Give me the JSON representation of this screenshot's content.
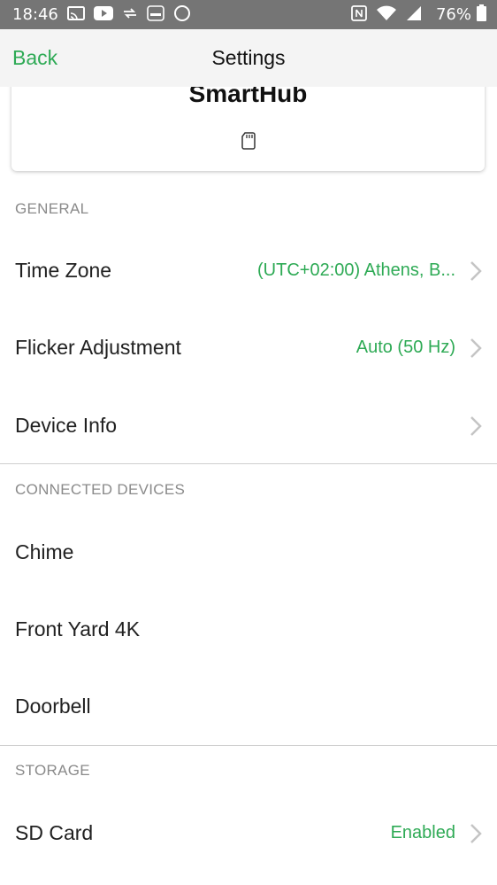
{
  "status_bar": {
    "time": "18:46",
    "battery": "76%",
    "icons_left": [
      "cast-icon",
      "youtube-icon",
      "sync-icon",
      "connect-icon",
      "circle-icon"
    ],
    "icons_right": [
      "nfc-icon",
      "wifi-icon",
      "signal-icon",
      "battery-icon"
    ]
  },
  "nav": {
    "back_label": "Back",
    "title": "Settings"
  },
  "device": {
    "name": "SmartHub",
    "icon": "sd-card-icon"
  },
  "sections": {
    "general": {
      "header": "GENERAL",
      "rows": [
        {
          "label": "Time Zone",
          "value": "(UTC+02:00) Athens, B..."
        },
        {
          "label": "Flicker Adjustment",
          "value": "Auto (50 Hz)"
        },
        {
          "label": "Device Info",
          "value": ""
        }
      ]
    },
    "connected": {
      "header": "CONNECTED DEVICES",
      "rows": [
        {
          "label": "Chime"
        },
        {
          "label": "Front Yard 4K"
        },
        {
          "label": "Doorbell"
        }
      ]
    },
    "storage": {
      "header": "STORAGE",
      "rows": [
        {
          "label": "SD Card",
          "value": "Enabled"
        }
      ]
    }
  },
  "colors": {
    "accent": "#2eaa55",
    "statusbar": "#757575",
    "navbar": "#f4f4f4",
    "header_text": "#8a8a8a"
  }
}
